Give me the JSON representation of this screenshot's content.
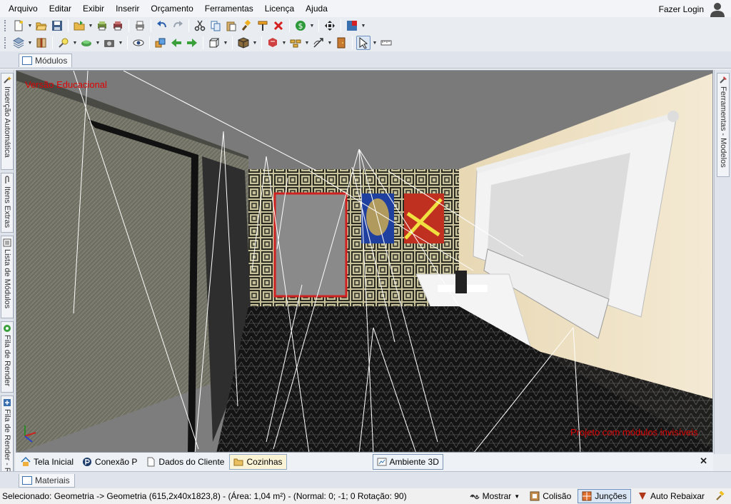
{
  "menu": {
    "items": [
      "Arquivo",
      "Editar",
      "Exibir",
      "Inserir",
      "Orçamento",
      "Ferramentas",
      "Licença",
      "Ajuda"
    ],
    "login_label": "Fazer Login"
  },
  "toolbar1": {
    "icons": [
      "new-icon",
      "open-icon",
      "save-icon",
      "folder-icon",
      "print-preview-icon",
      "print-setup-icon",
      "print-icon",
      "undo-icon",
      "redo-icon",
      "cut-icon",
      "copy-icon",
      "paste-icon",
      "paint-brush-icon",
      "paint-roller-icon",
      "delete-icon",
      "money-icon",
      "move-icon",
      "color-palette-icon"
    ]
  },
  "toolbar2": {
    "icons": [
      "layers-icon",
      "align-icon",
      "light-icon",
      "texture-icon",
      "camera-icon",
      "eye-icon",
      "cube-stack-icon",
      "arrow-left-icon",
      "arrow-right-icon",
      "view-box-icon",
      "box-3d-icon",
      "explode-icon",
      "grid-icon",
      "draw-icon",
      "door-icon",
      "select-cursor-icon",
      "measure-icon"
    ]
  },
  "modulos_tab": {
    "label": "Módulos"
  },
  "left_panel_tabs": [
    {
      "label": "Inserção Automática",
      "icon": "wand-icon"
    },
    {
      "label": "Itens Extras",
      "icon": "clip-icon"
    },
    {
      "label": "Lista de Módulos",
      "icon": "list-icon"
    },
    {
      "label": "Fila de Render",
      "icon": "render-icon"
    },
    {
      "label": "Fila de Render - Real",
      "icon": "render-real-icon"
    }
  ],
  "right_panel_tabs": [
    {
      "label": "Ferramentas - Modelos",
      "icon": "tools-icon"
    }
  ],
  "viewport": {
    "watermark_top": "Versão Educacional",
    "watermark_bottom": "Projeto com módulos invisíveis"
  },
  "doc_tabs": [
    {
      "label": "Tela Inicial",
      "icon": "home-icon",
      "state": "normal"
    },
    {
      "label": "Conexão P",
      "icon": "connect-icon",
      "state": "normal"
    },
    {
      "label": "Dados do Cliente",
      "icon": "document-icon",
      "state": "normal"
    },
    {
      "label": "Cozinhas",
      "icon": "folder-open-icon",
      "state": "active"
    },
    {
      "label": "Ambiente 3D",
      "icon": "ambient-icon",
      "state": "boxed"
    }
  ],
  "materiais_tab": {
    "label": "Materiais"
  },
  "status": {
    "text": "Selecionado: Geometria -> Geometria (615,2x40x1823,8) - (Área: 1,04 m²) - (Normal: 0; -1; 0 Rotação: 90)",
    "buttons": [
      {
        "label": "Mostrar",
        "icon": "show-icon",
        "dropdown": true,
        "pressed": false
      },
      {
        "label": "Colisão",
        "icon": "collision-icon",
        "dropdown": false,
        "pressed": false
      },
      {
        "label": "Junções",
        "icon": "junctions-icon",
        "dropdown": false,
        "pressed": true
      },
      {
        "label": "Auto Rebaixar",
        "icon": "auto-lower-icon",
        "dropdown": false,
        "pressed": false
      },
      {
        "label": "",
        "icon": "hammer-icon",
        "dropdown": false,
        "pressed": false
      }
    ]
  },
  "colors": {
    "accent": "#3a6fb0",
    "watermark_red": "#e00000",
    "wall_right": "#efe3c6",
    "ceiling": "#7c7c7c",
    "floor": "#1a1a1a"
  }
}
